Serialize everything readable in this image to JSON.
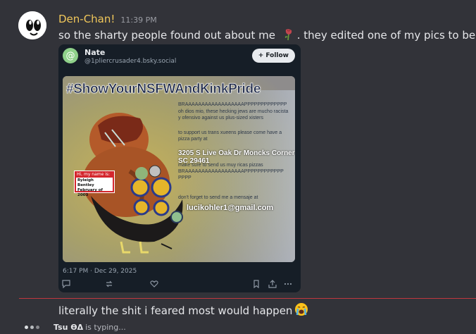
{
  "message1": {
    "username": "Den-Chan!",
    "timestamp": "11:39 PM",
    "text": "so the sharty people found out about me",
    "text_tail": ". they edited one of my pics to be this"
  },
  "embed": {
    "author_name": "Nate",
    "author_handle": "@1pliercrusader4.bsky.social",
    "follow_label": "+ Follow",
    "image_overlay": {
      "hashtag": "#ShowYourNSFWAndKinkPride",
      "line1": "BRAAAAAAAAAAAAAAAAAAPPPPPPPPPPPPP",
      "line2": "oh dios mio, these hecking jews are mucho racista y ofensivo against us plus-sized xisters",
      "line3": "to support us trans xueens please come have a pizza party at",
      "address": "3205 S Live Oak Dr Moncks Corner SC 29461",
      "line4": "make sure to send us muy ricas pizzas BRAAAAAAAAAAAAAAAAAAPPPPPPPPPPPP PPPP",
      "line5": "don't forget to send me a mensaje at",
      "email": "lucikohler1@gmail.com",
      "nametag_header": "Hi, my name is:",
      "nametag_name_1": "Ryleigh Bentley",
      "nametag_name_2": "February of 2003"
    },
    "post_date": "6:17 PM · Dec 29, 2025"
  },
  "message2": {
    "text": "literally the shit i feared most would happen"
  },
  "typing": {
    "user": "Tsu ϴΔ",
    "status": "is typing..."
  }
}
